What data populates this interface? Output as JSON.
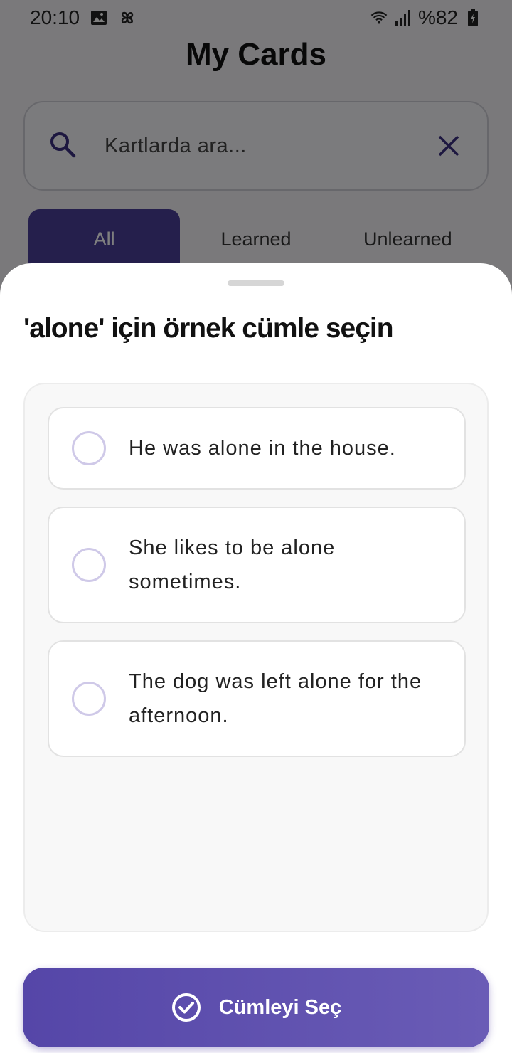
{
  "status_bar": {
    "time": "20:10",
    "battery": "%82"
  },
  "page": {
    "title": "My Cards",
    "search": {
      "placeholder": "Kartlarda ara..."
    },
    "tabs": [
      {
        "label": "All",
        "active": true
      },
      {
        "label": "Learned",
        "active": false
      },
      {
        "label": "Unlearned",
        "active": false
      }
    ]
  },
  "sheet": {
    "title": "'alone' için örnek cümle seçin",
    "options": [
      {
        "text": "He was alone in the house.",
        "selected": false
      },
      {
        "text": "She likes to be alone sometimes.",
        "selected": false
      },
      {
        "text": "The dog was left alone for the afternoon.",
        "selected": false
      }
    ],
    "select_button_label": "Cümleyi Seç"
  },
  "colors": {
    "accent": "#4b3f98",
    "button_start": "#5546a8",
    "button_end": "#6a5cb6",
    "radio_border": "#cfc9e8"
  },
  "icons": [
    "image-icon",
    "pinwheel-icon",
    "wifi-icon",
    "signal-icon",
    "battery-icon",
    "search-icon",
    "close-icon",
    "check-circle-icon"
  ]
}
